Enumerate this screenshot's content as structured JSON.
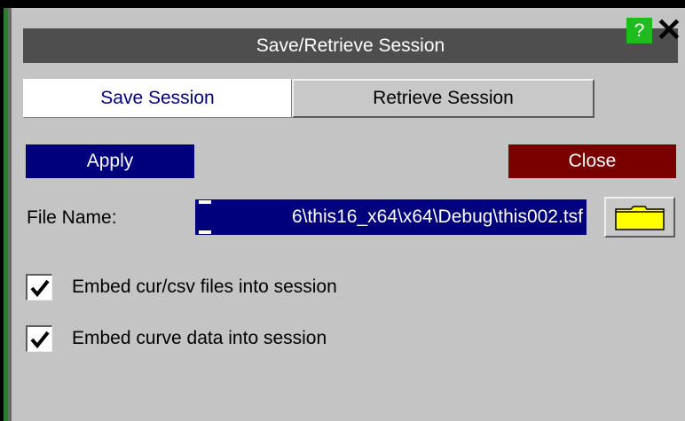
{
  "dialog": {
    "title": "Save/Retrieve Session",
    "help_label": "?",
    "close_symbol": "✕"
  },
  "tabs": [
    {
      "label": "Save Session",
      "active": true
    },
    {
      "label": "Retrieve Session",
      "active": false
    }
  ],
  "actions": {
    "apply_label": "Apply",
    "close_label": "Close"
  },
  "file": {
    "label": "File Name:",
    "value": "6\\this16_x64\\x64\\Debug\\this002.tsf",
    "browse_icon": "folder-icon"
  },
  "options": [
    {
      "label": "Embed cur/csv files into session",
      "checked": true
    },
    {
      "label": "Embed curve data into session",
      "checked": true
    }
  ],
  "colors": {
    "panel_bg": "#c4c4c4",
    "title_bg": "#4e4e4e",
    "apply_bg": "#00007c",
    "close_bg": "#7a0000",
    "help_bg": "#1fbc1f",
    "folder_fill": "#ffff00"
  }
}
